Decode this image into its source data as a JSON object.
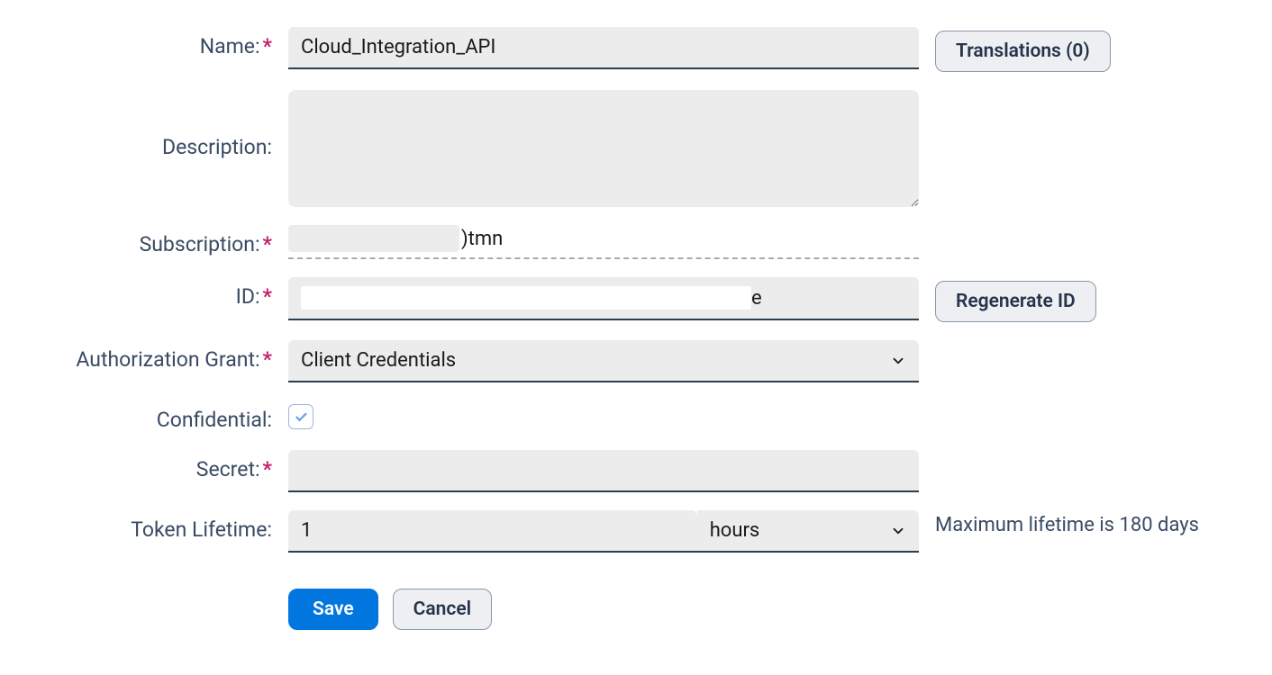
{
  "labels": {
    "name": "Name:",
    "description": "Description:",
    "subscription": "Subscription:",
    "id": "ID:",
    "authorization_grant": "Authorization Grant:",
    "confidential": "Confidential:",
    "secret": "Secret:",
    "token_lifetime": "Token Lifetime:"
  },
  "values": {
    "name": "Cloud_Integration_API",
    "description": "",
    "subscription_suffix": ")tmn",
    "id_suffix": "e",
    "authorization_grant": "Client Credentials",
    "confidential_checked": true,
    "secret": "",
    "token_lifetime_value": "1",
    "token_lifetime_unit": "hours"
  },
  "buttons": {
    "translations": "Translations (0)",
    "regenerate_id": "Regenerate ID",
    "save": "Save",
    "cancel": "Cancel"
  },
  "hints": {
    "token_lifetime": "Maximum lifetime is 180 days"
  }
}
